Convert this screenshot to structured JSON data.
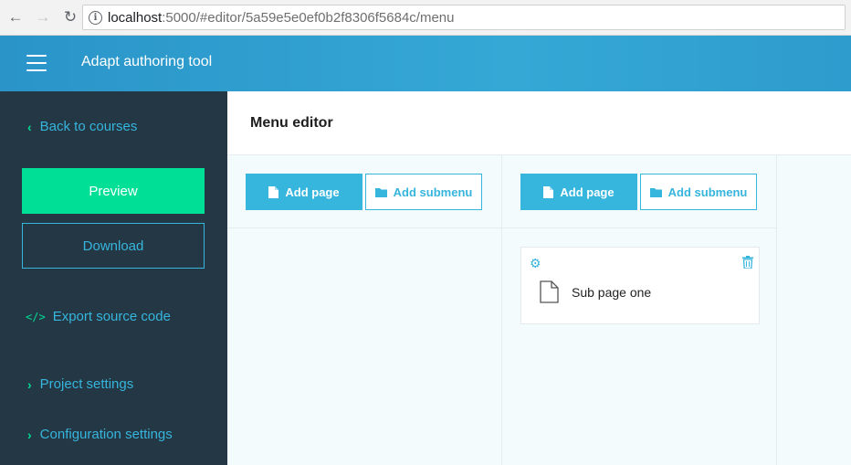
{
  "browser": {
    "url_host": "localhost",
    "url_path": ":5000/#editor/5a59e5e0ef0b2f8306f5684c/menu",
    "icons": {
      "back": "arrow-left-icon",
      "forward": "arrow-right-icon",
      "reload": "reload-icon",
      "info": "info-icon"
    }
  },
  "header": {
    "title": "Adapt authoring tool",
    "menu_icon": "hamburger-icon"
  },
  "sidebar": {
    "back_link": "Back to courses",
    "preview_label": "Preview",
    "download_label": "Download",
    "export_link": "Export source code",
    "project_settings": "Project settings",
    "configuration_settings": "Configuration settings"
  },
  "main": {
    "title": "Menu editor",
    "columns": [
      {
        "add_page_label": "Add page",
        "add_submenu_label": "Add submenu",
        "pages": []
      },
      {
        "add_page_label": "Add page",
        "add_submenu_label": "Add submenu",
        "pages": [
          {
            "title": "Sub page one"
          }
        ]
      }
    ]
  },
  "colors": {
    "accent": "#36b5dd",
    "green": "#00df96",
    "sidebar_bg": "#243744",
    "header_bg": "#2e9ccd"
  }
}
